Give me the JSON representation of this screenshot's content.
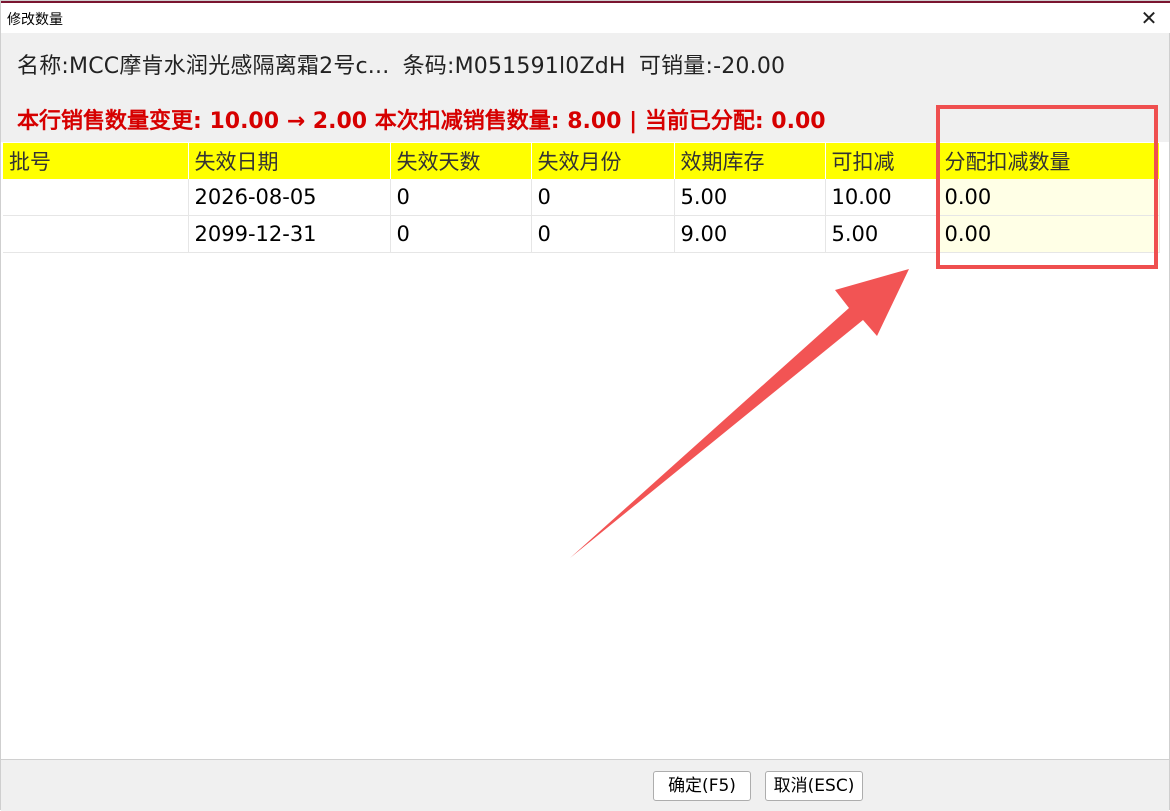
{
  "window": {
    "title": "修改数量",
    "close_glyph": "✕"
  },
  "info": {
    "name": "名称:MCC摩肯水润光感隔离霜2号c...",
    "barcode": "条码:M051591l0ZdH",
    "sellable": "可销量:-20.00"
  },
  "alert": {
    "text": "本行销售数量变更: 10.00 → 2.00  本次扣减销售数量: 8.00 | 当前已分配: 0.00"
  },
  "table": {
    "headers": [
      "批号",
      "失效日期",
      "失效天数",
      "失效月份",
      "效期库存",
      "可扣减",
      "分配扣减数量"
    ],
    "rows": [
      [
        "",
        "2026-08-05",
        "0",
        "0",
        "5.00",
        "10.00",
        "0.00"
      ],
      [
        "",
        "2099-12-31",
        "0",
        "0",
        "9.00",
        "5.00",
        "0.00"
      ]
    ]
  },
  "buttons": {
    "ok": "确定(F5)",
    "cancel": "取消(ESC)"
  },
  "colors": {
    "header_bg": "#ffff00",
    "alert_text": "#d60000",
    "annotation": "#ef4f4f",
    "alloc_bg": "#ffffe6"
  }
}
